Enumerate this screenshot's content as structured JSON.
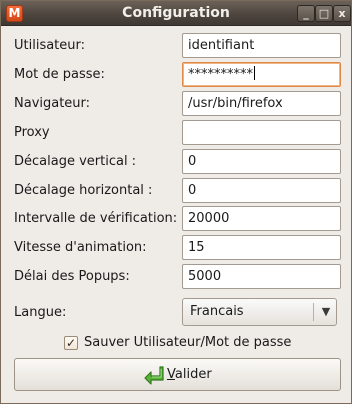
{
  "window": {
    "title": "Configuration",
    "app_icon": "M",
    "controls": {
      "minimize": "_",
      "maximize": "□",
      "close": "x"
    }
  },
  "form": {
    "utilisateur": {
      "label": "Utilisateur:",
      "value": "identifiant"
    },
    "mot_de_passe": {
      "label": "Mot de passe:",
      "value": "**********"
    },
    "navigateur": {
      "label": "Navigateur:",
      "value": "/usr/bin/firefox"
    },
    "proxy": {
      "label": "Proxy",
      "value": ""
    },
    "decalage_vertical": {
      "label": "Décalage vertical :",
      "value": "0"
    },
    "decalage_horizontal": {
      "label": "Décalage horizontal :",
      "value": "0"
    },
    "intervalle": {
      "label": "Intervalle de vérification:",
      "value": "20000"
    },
    "vitesse": {
      "label": "Vitesse d'animation:",
      "value": "15"
    },
    "delai": {
      "label": "Délai des Popups:",
      "value": "5000"
    },
    "langue": {
      "label": "Langue:",
      "value": "Francais"
    }
  },
  "save_credentials": {
    "label": "Sauver Utilisateur/Mot de passe",
    "checked": true,
    "mark": "✓"
  },
  "validate_button": {
    "first_letter": "V",
    "rest": "alider"
  }
}
